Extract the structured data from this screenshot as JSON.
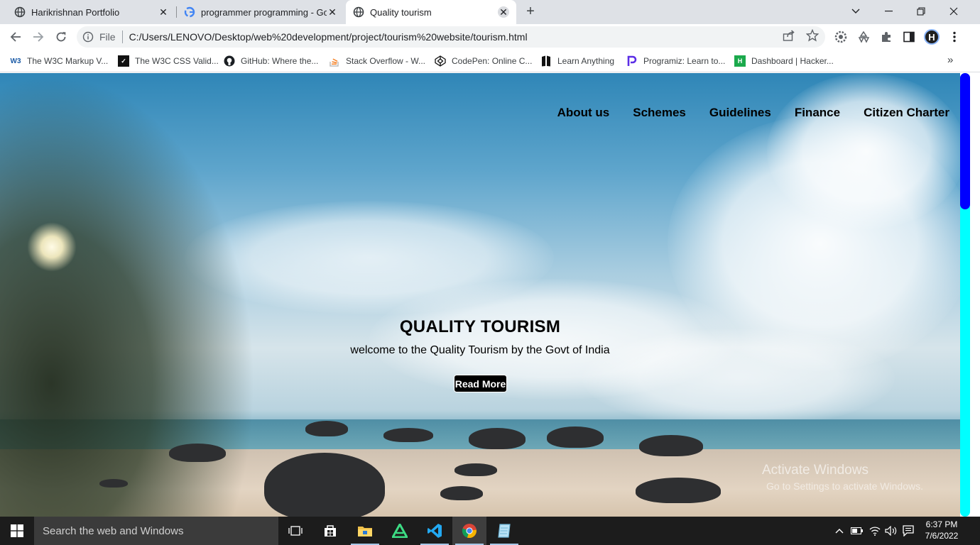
{
  "browser": {
    "tabs": [
      {
        "title": "Harikrishnan Portfolio",
        "icon": "globe-icon",
        "active": false
      },
      {
        "title": "programmer programming - Goo",
        "icon": "google-icon",
        "active": false
      },
      {
        "title": "Quality tourism",
        "icon": "globe-icon",
        "active": true
      }
    ],
    "address": {
      "protocol": "File",
      "url": "C:/Users/LENOVO/Desktop/web%20development/project/tourism%20website/tourism.html"
    },
    "avatar_letter": "H",
    "bookmarks": [
      {
        "label": "The W3C Markup V...",
        "icon": "w3c-icon"
      },
      {
        "label": "The W3C CSS Valid...",
        "icon": "css-validator-icon"
      },
      {
        "label": "GitHub: Where the...",
        "icon": "github-icon"
      },
      {
        "label": "Stack Overflow - W...",
        "icon": "stackoverflow-icon"
      },
      {
        "label": "CodePen: Online C...",
        "icon": "codepen-icon"
      },
      {
        "label": "Learn Anything",
        "icon": "learn-anything-icon"
      },
      {
        "label": "Programiz: Learn to...",
        "icon": "programiz-icon"
      },
      {
        "label": "Dashboard | Hacker...",
        "icon": "hackerrank-icon"
      }
    ]
  },
  "page": {
    "nav": [
      "About us",
      "Schemes",
      "Guidelines",
      "Finance",
      "Citizen Charter"
    ],
    "hero": {
      "title": "QUALITY TOURISM",
      "subtitle": "welcome to the Quality Tourism by the Govt of India",
      "button": "Read More"
    },
    "watermark": {
      "line1": "Activate Windows",
      "line2": "Go to Settings to activate Windows."
    },
    "scrollbar_position": 0
  },
  "taskbar": {
    "search_placeholder": "Search the web and Windows",
    "time": "6:37 PM",
    "date": "7/6/2022"
  },
  "colors": {
    "scroll_track": "#00ffff",
    "scroll_thumb": "#0000ff",
    "button_bg": "#000000"
  }
}
